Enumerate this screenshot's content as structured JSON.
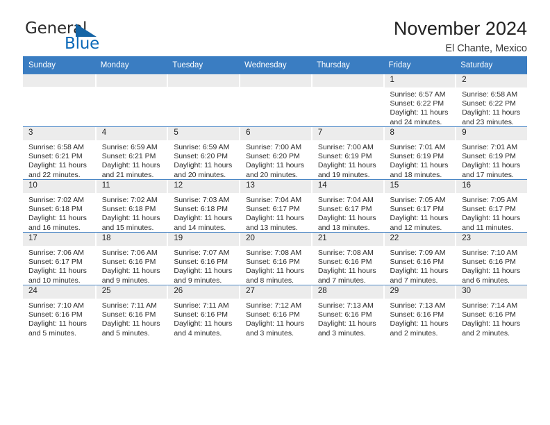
{
  "logo": {
    "word_one": "General",
    "word_two": "Blue",
    "triangle_icon": "triangle-icon"
  },
  "header": {
    "title": "November 2024",
    "subtitle": "El Chante, Mexico"
  },
  "colors": {
    "header_blue": "#3a7dc2",
    "grid_line_blue": "#4a86c5",
    "daynum_band": "#ececec",
    "logo_blue": "#0a68b8",
    "text": "#2b2b2b"
  },
  "weekday_headers": [
    "Sunday",
    "Monday",
    "Tuesday",
    "Wednesday",
    "Thursday",
    "Friday",
    "Saturday"
  ],
  "weeks": [
    [
      {
        "day": "",
        "sunrise": "",
        "sunset": "",
        "daylight_line1": "",
        "daylight_line2": ""
      },
      {
        "day": "",
        "sunrise": "",
        "sunset": "",
        "daylight_line1": "",
        "daylight_line2": ""
      },
      {
        "day": "",
        "sunrise": "",
        "sunset": "",
        "daylight_line1": "",
        "daylight_line2": ""
      },
      {
        "day": "",
        "sunrise": "",
        "sunset": "",
        "daylight_line1": "",
        "daylight_line2": ""
      },
      {
        "day": "",
        "sunrise": "",
        "sunset": "",
        "daylight_line1": "",
        "daylight_line2": ""
      },
      {
        "day": "1",
        "sunrise": "Sunrise: 6:57 AM",
        "sunset": "Sunset: 6:22 PM",
        "daylight_line1": "Daylight: 11 hours",
        "daylight_line2": "and 24 minutes."
      },
      {
        "day": "2",
        "sunrise": "Sunrise: 6:58 AM",
        "sunset": "Sunset: 6:22 PM",
        "daylight_line1": "Daylight: 11 hours",
        "daylight_line2": "and 23 minutes."
      }
    ],
    [
      {
        "day": "3",
        "sunrise": "Sunrise: 6:58 AM",
        "sunset": "Sunset: 6:21 PM",
        "daylight_line1": "Daylight: 11 hours",
        "daylight_line2": "and 22 minutes."
      },
      {
        "day": "4",
        "sunrise": "Sunrise: 6:59 AM",
        "sunset": "Sunset: 6:21 PM",
        "daylight_line1": "Daylight: 11 hours",
        "daylight_line2": "and 21 minutes."
      },
      {
        "day": "5",
        "sunrise": "Sunrise: 6:59 AM",
        "sunset": "Sunset: 6:20 PM",
        "daylight_line1": "Daylight: 11 hours",
        "daylight_line2": "and 20 minutes."
      },
      {
        "day": "6",
        "sunrise": "Sunrise: 7:00 AM",
        "sunset": "Sunset: 6:20 PM",
        "daylight_line1": "Daylight: 11 hours",
        "daylight_line2": "and 20 minutes."
      },
      {
        "day": "7",
        "sunrise": "Sunrise: 7:00 AM",
        "sunset": "Sunset: 6:19 PM",
        "daylight_line1": "Daylight: 11 hours",
        "daylight_line2": "and 19 minutes."
      },
      {
        "day": "8",
        "sunrise": "Sunrise: 7:01 AM",
        "sunset": "Sunset: 6:19 PM",
        "daylight_line1": "Daylight: 11 hours",
        "daylight_line2": "and 18 minutes."
      },
      {
        "day": "9",
        "sunrise": "Sunrise: 7:01 AM",
        "sunset": "Sunset: 6:19 PM",
        "daylight_line1": "Daylight: 11 hours",
        "daylight_line2": "and 17 minutes."
      }
    ],
    [
      {
        "day": "10",
        "sunrise": "Sunrise: 7:02 AM",
        "sunset": "Sunset: 6:18 PM",
        "daylight_line1": "Daylight: 11 hours",
        "daylight_line2": "and 16 minutes."
      },
      {
        "day": "11",
        "sunrise": "Sunrise: 7:02 AM",
        "sunset": "Sunset: 6:18 PM",
        "daylight_line1": "Daylight: 11 hours",
        "daylight_line2": "and 15 minutes."
      },
      {
        "day": "12",
        "sunrise": "Sunrise: 7:03 AM",
        "sunset": "Sunset: 6:18 PM",
        "daylight_line1": "Daylight: 11 hours",
        "daylight_line2": "and 14 minutes."
      },
      {
        "day": "13",
        "sunrise": "Sunrise: 7:04 AM",
        "sunset": "Sunset: 6:17 PM",
        "daylight_line1": "Daylight: 11 hours",
        "daylight_line2": "and 13 minutes."
      },
      {
        "day": "14",
        "sunrise": "Sunrise: 7:04 AM",
        "sunset": "Sunset: 6:17 PM",
        "daylight_line1": "Daylight: 11 hours",
        "daylight_line2": "and 13 minutes."
      },
      {
        "day": "15",
        "sunrise": "Sunrise: 7:05 AM",
        "sunset": "Sunset: 6:17 PM",
        "daylight_line1": "Daylight: 11 hours",
        "daylight_line2": "and 12 minutes."
      },
      {
        "day": "16",
        "sunrise": "Sunrise: 7:05 AM",
        "sunset": "Sunset: 6:17 PM",
        "daylight_line1": "Daylight: 11 hours",
        "daylight_line2": "and 11 minutes."
      }
    ],
    [
      {
        "day": "17",
        "sunrise": "Sunrise: 7:06 AM",
        "sunset": "Sunset: 6:17 PM",
        "daylight_line1": "Daylight: 11 hours",
        "daylight_line2": "and 10 minutes."
      },
      {
        "day": "18",
        "sunrise": "Sunrise: 7:06 AM",
        "sunset": "Sunset: 6:16 PM",
        "daylight_line1": "Daylight: 11 hours",
        "daylight_line2": "and 9 minutes."
      },
      {
        "day": "19",
        "sunrise": "Sunrise: 7:07 AM",
        "sunset": "Sunset: 6:16 PM",
        "daylight_line1": "Daylight: 11 hours",
        "daylight_line2": "and 9 minutes."
      },
      {
        "day": "20",
        "sunrise": "Sunrise: 7:08 AM",
        "sunset": "Sunset: 6:16 PM",
        "daylight_line1": "Daylight: 11 hours",
        "daylight_line2": "and 8 minutes."
      },
      {
        "day": "21",
        "sunrise": "Sunrise: 7:08 AM",
        "sunset": "Sunset: 6:16 PM",
        "daylight_line1": "Daylight: 11 hours",
        "daylight_line2": "and 7 minutes."
      },
      {
        "day": "22",
        "sunrise": "Sunrise: 7:09 AM",
        "sunset": "Sunset: 6:16 PM",
        "daylight_line1": "Daylight: 11 hours",
        "daylight_line2": "and 7 minutes."
      },
      {
        "day": "23",
        "sunrise": "Sunrise: 7:10 AM",
        "sunset": "Sunset: 6:16 PM",
        "daylight_line1": "Daylight: 11 hours",
        "daylight_line2": "and 6 minutes."
      }
    ],
    [
      {
        "day": "24",
        "sunrise": "Sunrise: 7:10 AM",
        "sunset": "Sunset: 6:16 PM",
        "daylight_line1": "Daylight: 11 hours",
        "daylight_line2": "and 5 minutes."
      },
      {
        "day": "25",
        "sunrise": "Sunrise: 7:11 AM",
        "sunset": "Sunset: 6:16 PM",
        "daylight_line1": "Daylight: 11 hours",
        "daylight_line2": "and 5 minutes."
      },
      {
        "day": "26",
        "sunrise": "Sunrise: 7:11 AM",
        "sunset": "Sunset: 6:16 PM",
        "daylight_line1": "Daylight: 11 hours",
        "daylight_line2": "and 4 minutes."
      },
      {
        "day": "27",
        "sunrise": "Sunrise: 7:12 AM",
        "sunset": "Sunset: 6:16 PM",
        "daylight_line1": "Daylight: 11 hours",
        "daylight_line2": "and 3 minutes."
      },
      {
        "day": "28",
        "sunrise": "Sunrise: 7:13 AM",
        "sunset": "Sunset: 6:16 PM",
        "daylight_line1": "Daylight: 11 hours",
        "daylight_line2": "and 3 minutes."
      },
      {
        "day": "29",
        "sunrise": "Sunrise: 7:13 AM",
        "sunset": "Sunset: 6:16 PM",
        "daylight_line1": "Daylight: 11 hours",
        "daylight_line2": "and 2 minutes."
      },
      {
        "day": "30",
        "sunrise": "Sunrise: 7:14 AM",
        "sunset": "Sunset: 6:16 PM",
        "daylight_line1": "Daylight: 11 hours",
        "daylight_line2": "and 2 minutes."
      }
    ]
  ]
}
